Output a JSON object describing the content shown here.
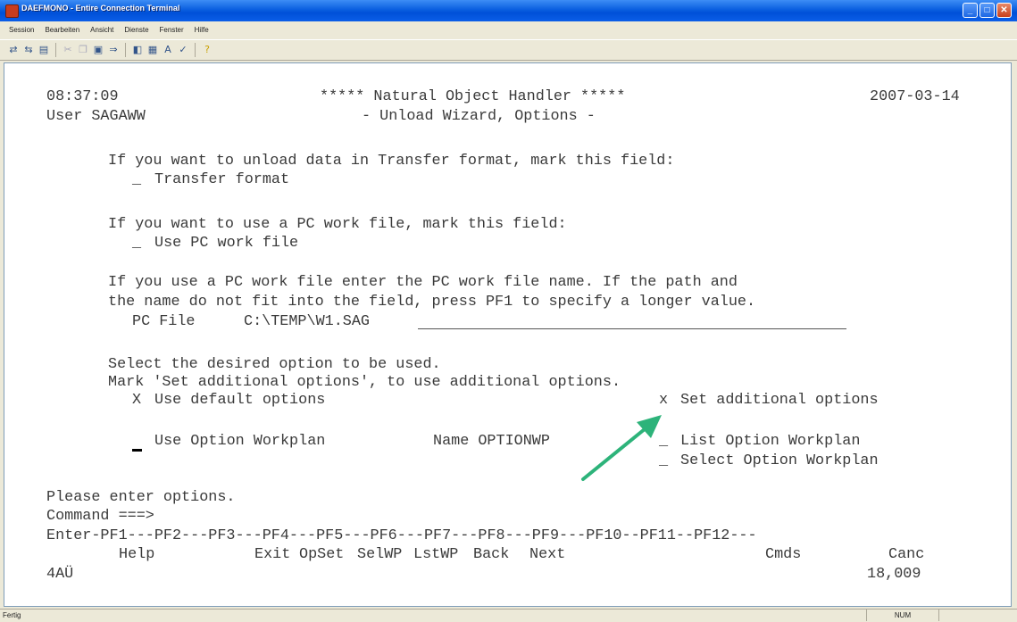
{
  "window": {
    "title": "DAEFMONO - Entire Connection Terminal"
  },
  "menu": [
    "Session",
    "Bearbeiten",
    "Ansicht",
    "Dienste",
    "Fenster",
    "Hilfe"
  ],
  "toolbar_icons": [
    "connect-icon",
    "disconnect-icon",
    "print-icon",
    "cut-icon",
    "copy-icon",
    "paste-icon",
    "transfer-icon",
    "send-icon",
    "receive-icon",
    "settings-icon",
    "check-icon",
    "help-icon"
  ],
  "screen": {
    "time": "08:37:09",
    "title": "***** Natural Object Handler *****",
    "date": "2007-03-14",
    "user": "User SAGAWW",
    "subtitle": "- Unload Wizard, Options -",
    "transfer_prompt": "If you want to unload data in Transfer format, mark this field:",
    "transfer_mark": "_",
    "transfer_label": "Transfer format",
    "workfile_prompt": "If you want to use a PC work file, mark this field:",
    "workfile_mark": "_",
    "workfile_label": "Use PC work file",
    "pcfile_info1": "If you use a PC work file enter the PC work file name. If the path and",
    "pcfile_info2": "the name do not fit into the field, press PF1 to specify a longer value.",
    "pcfile_label": "PC File",
    "pcfile_value": "C:\\TEMP\\W1.SAG",
    "select_info1": "Select the desired option to be used.",
    "select_info2": "Mark 'Set additional options', to use additional options.",
    "default_mark": "X",
    "default_label": "Use default options",
    "additional_mark": "x",
    "additional_label": "Set additional options",
    "workplan_label": "Use Option Workplan",
    "name_label": "Name OPTIONWP",
    "list_mark": "_",
    "list_label": "List Option Workplan",
    "selectwp_mark": "_",
    "selectwp_label": "Select Option Workplan",
    "message": "Please enter options.",
    "command_label": "Command ===>",
    "pf_line": "Enter-PF1---PF2---PF3---PF4---PF5---PF6---PF7---PF8---PF9---PF10--PF11--PF12---",
    "pf_labels": {
      "pf1": "Help",
      "pf3": "Exit",
      "pf4": "OpSet",
      "pf5": "SelWP",
      "pf6": "LstWP",
      "pf7": "Back",
      "pf8": "Next",
      "pf10": "Cmds",
      "pf12": "Canc"
    },
    "bottom_left": "4AÜ",
    "bottom_right": "18,009"
  },
  "statusbar": {
    "left": "Fertig",
    "num": "NUM"
  },
  "colors": {
    "terminal_text": "#3a3a3a",
    "arrow": "#2db37a",
    "titlebar": "#0a5fe0"
  }
}
